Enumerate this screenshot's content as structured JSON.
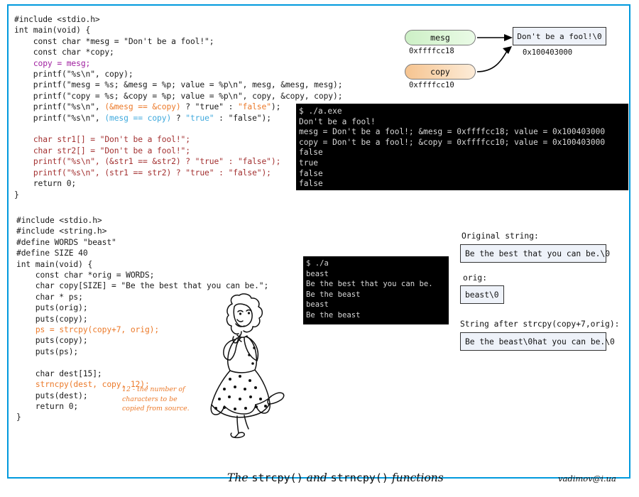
{
  "frame": {
    "border_color": "#0099dd"
  },
  "code_top": {
    "lines": [
      [
        {
          "t": "#include <stdio.h>",
          "c": "plain"
        }
      ],
      [
        {
          "t": "int main(void) {",
          "c": "plain"
        }
      ],
      [
        {
          "t": "    const char *mesg = \"Don't be a fool!\";",
          "c": "plain"
        }
      ],
      [
        {
          "t": "    const char *copy;",
          "c": "plain"
        }
      ],
      [
        {
          "t": "    ",
          "c": "plain"
        },
        {
          "t": "copy = mesg;",
          "c": "purple"
        }
      ],
      [
        {
          "t": "    printf(\"%s\\n\", copy);",
          "c": "plain"
        }
      ],
      [
        {
          "t": "    printf(\"mesg = %s; &mesg = %p; value = %p\\n\", mesg, &mesg, mesg);",
          "c": "plain"
        }
      ],
      [
        {
          "t": "    printf(\"copy = %s; &copy = %p; value = %p\\n\", copy, &copy, copy);",
          "c": "plain"
        }
      ],
      [
        {
          "t": "    printf(\"%s\\n\", ",
          "c": "plain"
        },
        {
          "t": "(&mesg == &copy)",
          "c": "orange"
        },
        {
          "t": " ? \"true\" : ",
          "c": "plain"
        },
        {
          "t": "\"false\"",
          "c": "orange"
        },
        {
          "t": ");",
          "c": "plain"
        }
      ],
      [
        {
          "t": "    printf(\"%s\\n\", ",
          "c": "plain"
        },
        {
          "t": "(mesg == copy)",
          "c": "blue"
        },
        {
          "t": " ? ",
          "c": "plain"
        },
        {
          "t": "\"true\"",
          "c": "blue"
        },
        {
          "t": " : \"false\");",
          "c": "plain"
        }
      ],
      [
        {
          "t": "",
          "c": "plain"
        }
      ],
      [
        {
          "t": "    ",
          "c": "plain"
        },
        {
          "t": "char str1[] = \"Don't be a fool!\";",
          "c": "maroon"
        }
      ],
      [
        {
          "t": "    ",
          "c": "plain"
        },
        {
          "t": "char str2[] = \"Don't be a fool!\";",
          "c": "maroon"
        }
      ],
      [
        {
          "t": "    ",
          "c": "plain"
        },
        {
          "t": "printf(\"%s\\n\", (&str1 == &str2) ? \"true\" : \"false\");",
          "c": "maroon"
        }
      ],
      [
        {
          "t": "    ",
          "c": "plain"
        },
        {
          "t": "printf(\"%s\\n\", (str1 == str2) ? \"true\" : \"false\");",
          "c": "maroon"
        }
      ],
      [
        {
          "t": "    return 0;",
          "c": "plain"
        }
      ],
      [
        {
          "t": "}",
          "c": "plain"
        }
      ]
    ]
  },
  "code_bottom": {
    "lines": [
      [
        {
          "t": "#include <stdio.h>",
          "c": "plain"
        }
      ],
      [
        {
          "t": "#include <string.h>",
          "c": "plain"
        }
      ],
      [
        {
          "t": "#define WORDS \"beast\"",
          "c": "plain"
        }
      ],
      [
        {
          "t": "#define SIZE 40",
          "c": "plain"
        }
      ],
      [
        {
          "t": "int main(void) {",
          "c": "plain"
        }
      ],
      [
        {
          "t": "    const char *orig = WORDS;",
          "c": "plain"
        }
      ],
      [
        {
          "t": "    char copy[SIZE] = \"Be the best that you can be.\";",
          "c": "plain"
        }
      ],
      [
        {
          "t": "    char * ps;",
          "c": "plain"
        }
      ],
      [
        {
          "t": "    puts(orig);",
          "c": "plain"
        }
      ],
      [
        {
          "t": "    puts(copy);",
          "c": "plain"
        }
      ],
      [
        {
          "t": "    ",
          "c": "plain"
        },
        {
          "t": "ps = strcpy(copy+7, orig);",
          "c": "orange"
        }
      ],
      [
        {
          "t": "    puts(copy);",
          "c": "plain"
        }
      ],
      [
        {
          "t": "    puts(ps);",
          "c": "plain"
        }
      ],
      [
        {
          "t": "",
          "c": "plain"
        }
      ],
      [
        {
          "t": "    char dest[15];",
          "c": "plain"
        }
      ],
      [
        {
          "t": "    ",
          "c": "plain"
        },
        {
          "t": "strncpy(dest, copy, 12);",
          "c": "orange"
        }
      ],
      [
        {
          "t": "    puts(dest);",
          "c": "plain"
        }
      ],
      [
        {
          "t": "    return 0;",
          "c": "plain"
        }
      ],
      [
        {
          "t": "}",
          "c": "plain"
        }
      ]
    ]
  },
  "terminal_top": {
    "text": "$ ./a.exe\nDon't be a fool!\nmesg = Don't be a fool!; &mesg = 0xffffcc18; value = 0x100403000\ncopy = Don't be a fool!; &copy = 0xffffcc10; value = 0x100403000\nfalse\ntrue\nfalse\nfalse"
  },
  "terminal_bottom": {
    "text": "$ ./a\nbeast\nBe the best that you can be.\nBe the beast\nbeast\nBe the beast"
  },
  "diagram": {
    "mesg_label": "mesg",
    "mesg_address": "0xffffcc18",
    "copy_label": "copy",
    "copy_address": "0xffffcc10",
    "memory_value": "Don't be a fool!\\0",
    "memory_address": "0x100403000",
    "mesg_color": "#cdf0c6",
    "copy_color": "#f6c490"
  },
  "string_boxes": {
    "original_label": "Original string:",
    "original_value": "Be the best that you can be.\\0",
    "orig_label": "orig:",
    "orig_value": "beast\\0",
    "after_label": "String after strcpy(copy+7,orig):",
    "after_value": "Be the beast\\0hat you can be.\\0"
  },
  "note": {
    "text": "12 - the number of characters to be copied from source.",
    "color": "#ec7a2a"
  },
  "footer": {
    "title_prefix": "The ",
    "title_fn1": "strcpy()",
    "title_middle": " and ",
    "title_fn2": "strncpy()",
    "title_suffix": " functions",
    "email": "vadimov@i.ua"
  }
}
